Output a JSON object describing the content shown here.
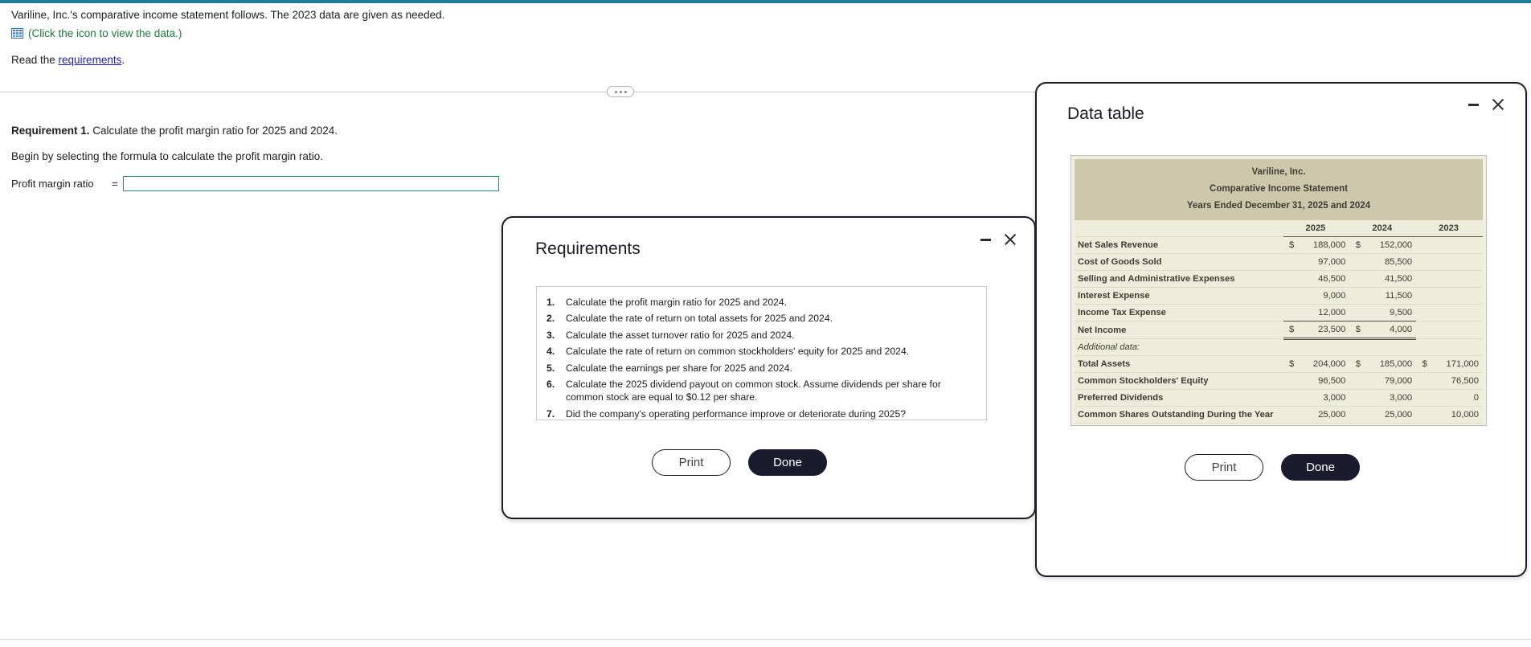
{
  "theme": {
    "accent": "#1f7a99",
    "link": "#2222bb",
    "green": "#1d7a3c",
    "dialog_border": "#1b1b26",
    "table_banner": "#cdc8ab",
    "table_body": "#eeecdb"
  },
  "problem": {
    "intro": "Variline, Inc.'s comparative income statement follows. The 2023 data are given as needed.",
    "icon_hint": "(Click the icon to view the data.)",
    "read_prefix": "Read the ",
    "read_link": "requirements",
    "read_suffix": "."
  },
  "work": {
    "requirement_label": "Requirement 1.",
    "requirement_text": " Calculate the profit margin ratio for 2025 and 2024.",
    "instruction": "Begin by selecting the formula to calculate the profit margin ratio.",
    "formula_label": "Profit margin ratio",
    "equals": "=",
    "formula_value": "",
    "formula_placeholder": ""
  },
  "requirements_dialog": {
    "title": "Requirements",
    "minimize_label": "Minimize",
    "close_label": "Close",
    "items": [
      {
        "num": "1.",
        "text": "Calculate the profit margin ratio for 2025 and 2024."
      },
      {
        "num": "2.",
        "text": "Calculate the rate of return on total assets for 2025 and 2024."
      },
      {
        "num": "3.",
        "text": "Calculate the asset turnover ratio for 2025 and 2024."
      },
      {
        "num": "4.",
        "text": "Calculate the rate of return on common stockholders' equity for 2025 and 2024."
      },
      {
        "num": "5.",
        "text": "Calculate the earnings per share for 2025 and 2024."
      },
      {
        "num": "6.",
        "text": "Calculate the 2025 dividend payout on common stock. Assume dividends per share for common stock are equal to $0.12 per share."
      },
      {
        "num": "7.",
        "text": "Did the company's operating performance improve or deteriorate during 2025?"
      }
    ],
    "print_label": "Print",
    "done_label": "Done"
  },
  "data_dialog": {
    "title": "Data table",
    "minimize_label": "Minimize",
    "close_label": "Close",
    "print_label": "Print",
    "done_label": "Done",
    "banner": {
      "line1": "Variline, Inc.",
      "line2": "Comparative Income Statement",
      "line3": "Years Ended December 31, 2025 and 2024"
    },
    "columns": [
      "2025",
      "2024",
      "2023"
    ],
    "rows": [
      {
        "label": "Net Sales Revenue",
        "c2025": "$",
        "v2025": "188,000",
        "c2024": "$",
        "v2024": "152,000",
        "c2023": "",
        "v2023": ""
      },
      {
        "label": "Cost of Goods Sold",
        "c2025": "",
        "v2025": "97,000",
        "c2024": "",
        "v2024": "85,500",
        "c2023": "",
        "v2023": ""
      },
      {
        "label": "Selling and Administrative Expenses",
        "c2025": "",
        "v2025": "46,500",
        "c2024": "",
        "v2024": "41,500",
        "c2023": "",
        "v2023": ""
      },
      {
        "label": "Interest Expense",
        "c2025": "",
        "v2025": "9,000",
        "c2024": "",
        "v2024": "11,500",
        "c2023": "",
        "v2023": ""
      },
      {
        "label": "Income Tax Expense",
        "c2025": "",
        "v2025": "12,000",
        "c2024": "",
        "v2024": "9,500",
        "c2023": "",
        "v2023": "",
        "rule": "single"
      },
      {
        "label": "Net Income",
        "c2025": "$",
        "v2025": "23,500",
        "c2024": "$",
        "v2024": "4,000",
        "c2023": "",
        "v2023": "",
        "rule": "double"
      },
      {
        "label": "Additional data:",
        "c2025": "",
        "v2025": "",
        "c2024": "",
        "v2024": "",
        "c2023": "",
        "v2023": "",
        "style": "italic"
      },
      {
        "label": "Total Assets",
        "c2025": "$",
        "v2025": "204,000",
        "c2024": "$",
        "v2024": "185,000",
        "c2023": "$",
        "v2023": "171,000"
      },
      {
        "label": "Common Stockholders' Equity",
        "c2025": "",
        "v2025": "96,500",
        "c2024": "",
        "v2024": "79,000",
        "c2023": "",
        "v2023": "76,500"
      },
      {
        "label": "Preferred Dividends",
        "c2025": "",
        "v2025": "3,000",
        "c2024": "",
        "v2024": "3,000",
        "c2023": "",
        "v2023": "0"
      },
      {
        "label": "Common Shares Outstanding During the Year",
        "c2025": "",
        "v2025": "25,000",
        "c2024": "",
        "v2024": "25,000",
        "c2023": "",
        "v2023": "10,000"
      }
    ]
  }
}
